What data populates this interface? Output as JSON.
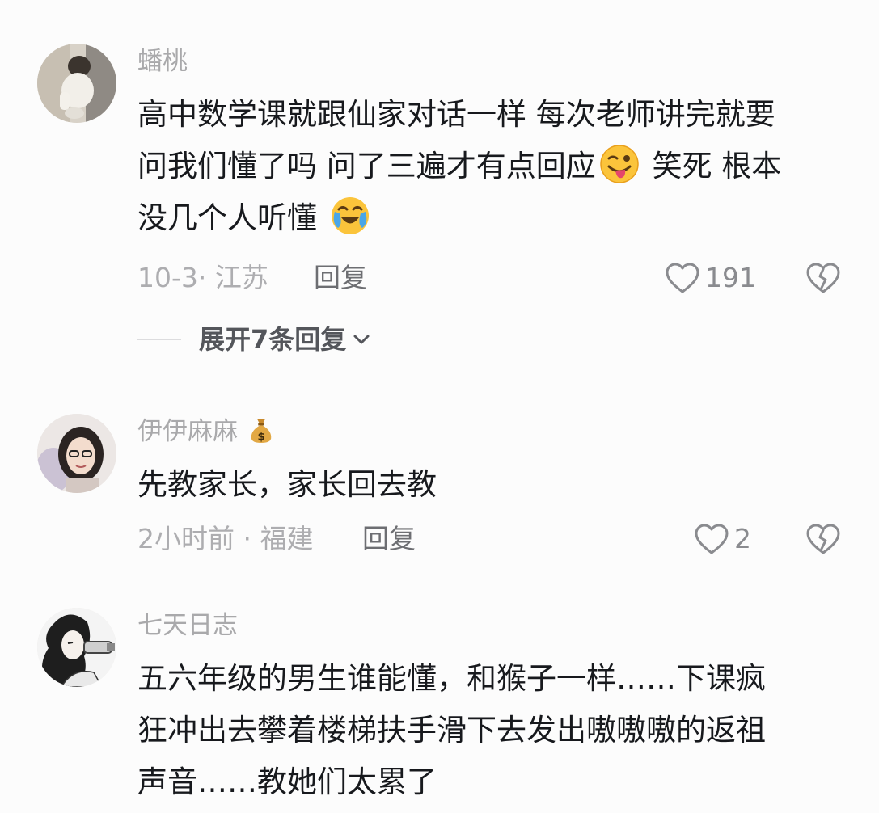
{
  "comments": [
    {
      "username": "蟠桃",
      "lines": [
        [
          "高中数学课就跟仙家对话一样 每次老师讲完就要"
        ],
        [
          "问我们懂了吗 问了三遍才有点回应",
          "emoji:wink-tongue",
          " 笑死 根本"
        ],
        [
          "没几个人听懂 ",
          "emoji:crying-laughing"
        ]
      ],
      "time_location": "10-3· 江苏",
      "reply_label": "回复",
      "likes": "191",
      "expand_label": "展开7条回复"
    },
    {
      "username": "伊伊麻麻",
      "badge_icon": "money-bag-icon",
      "lines": [
        [
          "先教家长，家长回去教"
        ]
      ],
      "time_location": "2小时前 · 福建",
      "reply_label": "回复",
      "likes": "2"
    },
    {
      "username": "七天日志",
      "lines": [
        [
          "五六年级的男生谁能懂，和猴子一样……下课疯"
        ],
        [
          "狂冲出去攀着楼梯扶手滑下去发出嗷嗷嗷的返祖"
        ],
        [
          "声音……教她们太累了"
        ]
      ]
    }
  ],
  "icons": {
    "like": "heart-outline-icon",
    "dislike": "broken-heart-icon",
    "expand": "chevron-down-icon"
  },
  "colors": {
    "username": "#a9a9ab",
    "body": "#17191d",
    "meta": "#adadb0",
    "reply": "#6d6e72",
    "icon_stroke": "#8a8b8f"
  }
}
